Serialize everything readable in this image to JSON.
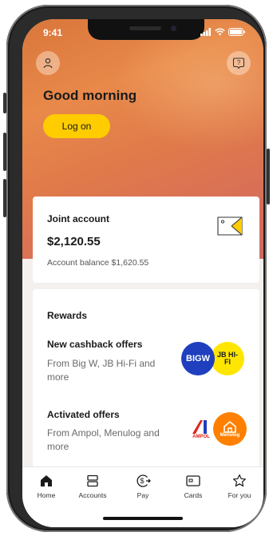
{
  "status": {
    "time": "9:41"
  },
  "header": {
    "greeting": "Good morning",
    "logon_label": "Log on"
  },
  "account": {
    "name": "Joint account",
    "amount": "$2,120.55",
    "balance": "Account balance $1,620.55"
  },
  "rewards": {
    "title": "Rewards",
    "offers": [
      {
        "title": "New cashback offers",
        "subtitle": "From Big W, JB Hi-Fi and more",
        "logos": [
          "BIGW",
          "JB HI-FI"
        ]
      },
      {
        "title": "Activated offers",
        "subtitle": "From Ampol, Menulog and more",
        "logos": [
          "AMPOL",
          "Menulog"
        ]
      }
    ]
  },
  "tabs": [
    {
      "label": "Home",
      "icon": "home-icon"
    },
    {
      "label": "Accounts",
      "icon": "accounts-icon"
    },
    {
      "label": "Pay",
      "icon": "pay-icon"
    },
    {
      "label": "Cards",
      "icon": "cards-icon"
    },
    {
      "label": "For you",
      "icon": "star-icon"
    }
  ],
  "colors": {
    "accent": "#ffcc00",
    "hero_start": "#d9763a",
    "hero_end": "#cf6a60",
    "bigw_blue": "#1f3fbf",
    "jb_yellow": "#ffe600",
    "ampol_red": "#e2231a",
    "menulog_orange": "#ff8000"
  }
}
